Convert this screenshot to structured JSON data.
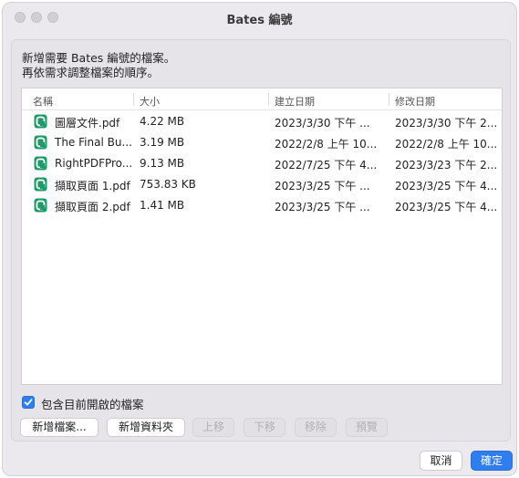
{
  "window": {
    "title": "Bates 編號"
  },
  "instructions": {
    "line1": "新增需要 Bates 編號的檔案。",
    "line2": "再依需求調整檔案的順序。"
  },
  "table": {
    "columns": {
      "name": "名稱",
      "size": "大小",
      "created": "建立日期",
      "modified": "修改日期"
    },
    "rows": [
      {
        "name": "圖層文件.pdf",
        "size": "4.22 MB",
        "created": "2023/3/30 下午 ...",
        "modified": "2023/3/30 下午 2..."
      },
      {
        "name": "The Final Bu...",
        "size": "3.19 MB",
        "created": "2022/2/8 上午 10...",
        "modified": "2022/2/8 上午 10..."
      },
      {
        "name": "RightPDFPro...",
        "size": "9.13 MB",
        "created": "2022/7/25 下午 4...",
        "modified": "2023/3/23 下午 2..."
      },
      {
        "name": "擷取頁面 1.pdf",
        "size": "753.83 KB",
        "created": "2023/3/25 下午 ...",
        "modified": "2023/3/25 下午 4..."
      },
      {
        "name": "擷取頁面 2.pdf",
        "size": "1.41 MB",
        "created": "2023/3/25 下午 ...",
        "modified": "2023/3/25 下午 4..."
      }
    ]
  },
  "options": {
    "include_open_files_label": "包含目前開啟的檔案",
    "include_open_files_checked": true
  },
  "buttons": {
    "add_files": "新增檔案...",
    "add_folder": "新增資料夾",
    "move_up": "上移",
    "move_down": "下移",
    "remove": "移除",
    "preview": "預覽",
    "cancel": "取消",
    "ok": "確定"
  },
  "colors": {
    "accent": "#2f7ef0",
    "file_icon": "#1f9a6a"
  },
  "icons": {
    "file": "pdf-file-icon",
    "checkbox": "checkmark-icon"
  }
}
